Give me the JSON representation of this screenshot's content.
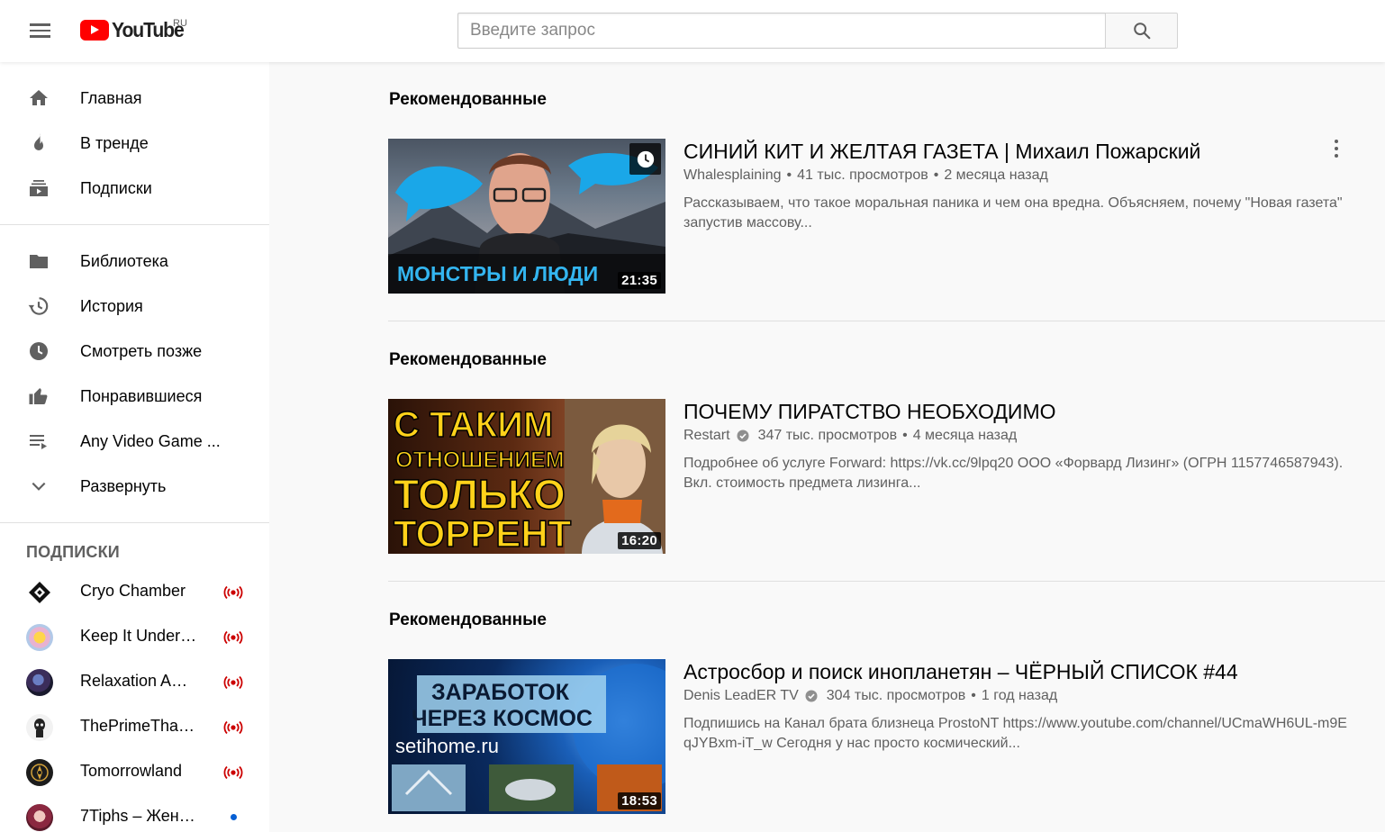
{
  "header": {
    "logo_text": "YouTube",
    "logo_region": "RU",
    "search_placeholder": "Введите запрос"
  },
  "sidebar": {
    "primary": [
      {
        "label": "Главная",
        "icon": "home-icon"
      },
      {
        "label": "В тренде",
        "icon": "trending-icon"
      },
      {
        "label": "Подписки",
        "icon": "subscriptions-icon"
      }
    ],
    "library": [
      {
        "label": "Библиотека",
        "icon": "library-icon"
      },
      {
        "label": "История",
        "icon": "history-icon"
      },
      {
        "label": "Смотреть позже",
        "icon": "watch-later-icon"
      },
      {
        "label": "Понравившиеся",
        "icon": "liked-icon"
      },
      {
        "label": "Any Video Game ...",
        "icon": "playlist-icon"
      },
      {
        "label": "Развернуть",
        "icon": "chevron-down-icon"
      }
    ],
    "subscriptions_title": "ПОДПИСКИ",
    "subscriptions": [
      {
        "label": "Cryo Chamber",
        "status": "live"
      },
      {
        "label": "Keep It Undergr...",
        "status": "live"
      },
      {
        "label": "Relaxation Amb...",
        "status": "live"
      },
      {
        "label": "ThePrimeThanat...",
        "status": "live"
      },
      {
        "label": "Tomorrowland",
        "status": "live"
      },
      {
        "label": "7Tiphs – Женск...",
        "status": "new"
      }
    ]
  },
  "shelves": [
    {
      "title": "Рекомендованные",
      "video": {
        "title": "СИНИЙ КИТ И ЖЕЛТАЯ ГАЗЕТА | Михаил Пожарский",
        "channel": "Whalesplaining",
        "verified": false,
        "views": "41 тыс. просмотров",
        "age": "2 месяца назад",
        "description": "Рассказываем, что такое моральная паника и чем она вредна. Объясняем, почему \"Новая газета\" запустив массову...",
        "duration": "21:35",
        "thumb_text": "МОНСТРЫ И ЛЮДИ"
      }
    },
    {
      "title": "Рекомендованные",
      "video": {
        "title": "ПОЧЕМУ ПИРАТСТВО НЕОБХОДИМО",
        "channel": "Restart",
        "verified": true,
        "views": "347 тыс. просмотров",
        "age": "4 месяца назад",
        "description": "Подробнее об услуге Forward: https://vk.cc/9lpq20 ООО «Форвард Лизинг» (ОГРН 1157746587943). Вкл. стоимость предмета лизинга...",
        "duration": "16:20",
        "thumb_lines": [
          "С ТАКИМ",
          "ОТНОШЕНИЕМ",
          "ТОЛЬКО",
          "ТОРРЕНТ"
        ]
      }
    },
    {
      "title": "Рекомендованные",
      "video": {
        "title": "Астросбор и поиск инопланетян – ЧЁРНЫЙ СПИСОК #44",
        "channel": "Denis LeadER TV",
        "verified": true,
        "views": "304 тыс. просмотров",
        "age": "1 год назад",
        "description": "Подпишись на Канал брата близнеца ProstoNT https://www.youtube.com/channel/UCmaWH6UL-m9EqJYBxm-iT_w Сегодня у нас просто космический...",
        "duration": "18:53",
        "thumb_lines": [
          "ЗАРАБОТОК",
          "ЧЕРЕЗ КОСМОС"
        ],
        "thumb_site": "setihome.ru"
      }
    }
  ],
  "colors": {
    "brand_red": "#ff0000",
    "live_red": "#cc0000",
    "new_dot": "#065fd4",
    "text_primary": "#030303",
    "text_secondary": "#606060"
  }
}
